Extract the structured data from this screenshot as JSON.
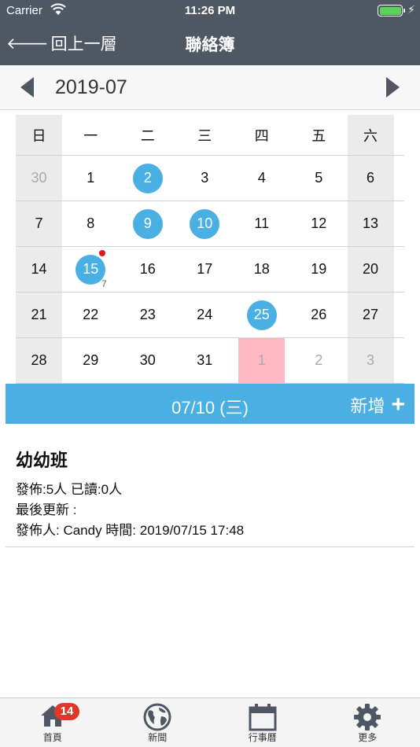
{
  "status": {
    "carrier": "Carrier",
    "time": "11:26 PM"
  },
  "nav": {
    "back_label": "回上一層",
    "title": "聯絡簿"
  },
  "month": {
    "label": "2019-07"
  },
  "calendar": {
    "weekdays": [
      "日",
      "一",
      "二",
      "三",
      "四",
      "五",
      "六"
    ],
    "weeks": [
      [
        {
          "d": "30",
          "other": true
        },
        {
          "d": "1"
        },
        {
          "d": "2",
          "event": true
        },
        {
          "d": "3"
        },
        {
          "d": "4"
        },
        {
          "d": "5"
        },
        {
          "d": "6"
        }
      ],
      [
        {
          "d": "7"
        },
        {
          "d": "8"
        },
        {
          "d": "9",
          "event": true
        },
        {
          "d": "10",
          "event": true
        },
        {
          "d": "11"
        },
        {
          "d": "12"
        },
        {
          "d": "13"
        }
      ],
      [
        {
          "d": "14"
        },
        {
          "d": "15",
          "event": true,
          "dot": true,
          "count": "7"
        },
        {
          "d": "16"
        },
        {
          "d": "17"
        },
        {
          "d": "18"
        },
        {
          "d": "19"
        },
        {
          "d": "20"
        }
      ],
      [
        {
          "d": "21"
        },
        {
          "d": "22"
        },
        {
          "d": "23"
        },
        {
          "d": "24"
        },
        {
          "d": "25",
          "event": true
        },
        {
          "d": "26"
        },
        {
          "d": "27"
        }
      ],
      [
        {
          "d": "28"
        },
        {
          "d": "29"
        },
        {
          "d": "30"
        },
        {
          "d": "31"
        },
        {
          "d": "1",
          "other": true,
          "today": true
        },
        {
          "d": "2",
          "other": true
        },
        {
          "d": "3",
          "other": true
        }
      ]
    ]
  },
  "selected": {
    "date_label": "07/10 (三)",
    "add_label": "新增",
    "add_icon": "plus-icon"
  },
  "entry": {
    "class_name": "幼幼班",
    "line1": "發佈:5人 已讀:0人",
    "line2": "最後更新 :",
    "line3": "發佈人: Candy 時間: 2019/07/15 17:48"
  },
  "tabs": [
    {
      "label": "首頁",
      "icon": "home-icon",
      "badge": "14"
    },
    {
      "label": "新聞",
      "icon": "globe-icon"
    },
    {
      "label": "行事曆",
      "icon": "calendar-icon"
    },
    {
      "label": "更多",
      "icon": "gear-icon"
    }
  ],
  "colors": {
    "nav": "#4f5763",
    "accent": "#4ab0e4",
    "today": "#fdb8c2",
    "badge": "#e3362b",
    "dot": "#e3141a"
  }
}
